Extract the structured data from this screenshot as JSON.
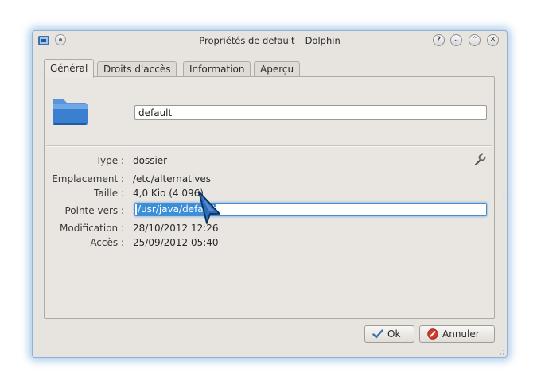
{
  "window": {
    "title": "Propriétés de default – Dolphin",
    "controls": [
      "?",
      "⌄",
      "⌃",
      "✕"
    ]
  },
  "tabs": [
    {
      "label": "Général",
      "active": true
    },
    {
      "label": "Droits d'accès",
      "active": false
    },
    {
      "label": "Information",
      "active": false
    },
    {
      "label": "Aperçu",
      "active": false
    }
  ],
  "general": {
    "name_value": "default",
    "fields": {
      "type_label": "Type :",
      "type_value": "dossier",
      "location_label": "Emplacement :",
      "location_value": "/etc/alternatives",
      "size_label": "Taille :",
      "size_value": "4,0 Kio (4 096)",
      "link_label": "Pointe vers :",
      "link_value": "/usr/java/default",
      "modified_label": "Modification :",
      "modified_value": "28/10/2012 12:26",
      "accessed_label": "Accès :",
      "accessed_value": "25/09/2012 05:40"
    }
  },
  "buttons": {
    "ok_label": "Ok",
    "cancel_label": "Annuler"
  },
  "colors": {
    "selection": "#3b8fd9",
    "window_glow": "#6ea5dc",
    "folder": "#3a7fd0"
  },
  "icons": [
    "dolphin-app-icon",
    "window-menu-icon",
    "folder-icon",
    "wrench-icon",
    "pointer-cursor-icon",
    "check-icon",
    "cancel-icon"
  ]
}
